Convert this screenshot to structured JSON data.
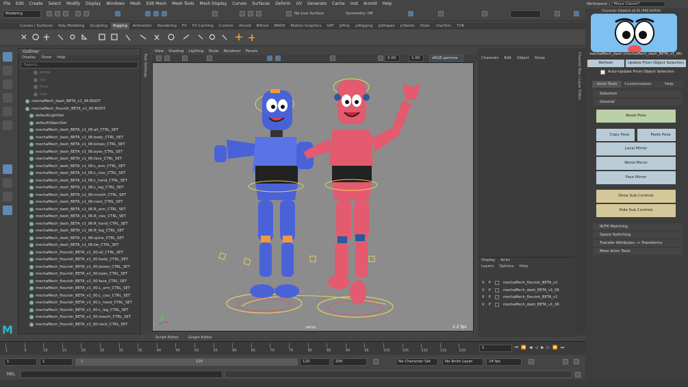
{
  "menubar": [
    "File",
    "Edit",
    "Create",
    "Select",
    "Modify",
    "Display",
    "Windows",
    "Mesh",
    "Edit Mesh",
    "Mesh Tools",
    "Mesh Display",
    "Curves",
    "Surfaces",
    "Deform",
    "UV",
    "Generate",
    "Cache",
    "mst",
    "Arnold",
    "Help"
  ],
  "status": {
    "mode": "Modeling",
    "live_surface": "No Live Surface",
    "symmetry": "Symmetry: Off"
  },
  "workspace": {
    "label": "Workspace :",
    "value": "Maya Classic*"
  },
  "shelf_tabs": [
    "Curves / Surfaces",
    "Poly Modeling",
    "Sculpting",
    "Rigging",
    "Animation",
    "Rendering",
    "FX",
    "FX Caching",
    "Custom",
    "Arnold",
    "Bifrost",
    "MASH",
    "Motion Graphics",
    "SAT",
    "jsPoly",
    "jsRigging",
    "jsShapes",
    "jsTanim",
    "XGen",
    "charSim",
    "TUR"
  ],
  "shelf_active": "Rigging",
  "outliner": {
    "title": "Outliner",
    "menu": [
      "Display",
      "Show",
      "Help"
    ],
    "search_placeholder": "Search...",
    "cameras": [
      "persp",
      "top",
      "front",
      "side"
    ],
    "rows": [
      "mechaMech_dash_BETA_v1_06:ROOT",
      "mechaMech_flourish_BETA_v1_00:ROOT",
      "defaultLightSet",
      "defaultObjectSet",
      "mechaMech_dash_BETA_v1_06:all_CTRL_SET",
      "mechaMech_dash_BETA_v1_06:body_CTRL_SET",
      "mechaMech_dash_BETA_v1_06:brows_CTRL_SET",
      "mechaMech_dash_BETA_v1_06:eyes_CTRL_SET",
      "mechaMech_dash_BETA_v1_06:face_CTRL_SET",
      "mechaMech_dash_BETA_v1_06:L_arm_CTRL_SET",
      "mechaMech_dash_BETA_v1_06:L_clav_CTRL_SET",
      "mechaMech_dash_BETA_v1_06:L_hand_CTRL_SET",
      "mechaMech_dash_BETA_v1_06:L_leg_CTRL_SET",
      "mechaMech_dash_BETA_v1_06:mouth_CTRL_SET",
      "mechaMech_dash_BETA_v1_06:neck_CTRL_SET",
      "mechaMech_dash_BETA_v1_06:R_arm_CTRL_SET",
      "mechaMech_dash_BETA_v1_06:R_clav_CTRL_SET",
      "mechaMech_dash_BETA_v1_06:R_hand_CTRL_SET",
      "mechaMech_dash_BETA_v1_06:R_leg_CTRL_SET",
      "mechaMech_dash_BETA_v1_06:spine_CTRL_SET",
      "mechaMech_dash_BETA_v1_06:tie_CTRL_SET",
      "mechaMech_flourish_BETA_v1_00:all_CTRL_SET",
      "mechaMech_flourish_BETA_v1_00:body_CTRL_SET",
      "mechaMech_flourish_BETA_v1_00:brows_CTRL_SET",
      "mechaMech_flourish_BETA_v1_00:eyes_CTRL_SET",
      "mechaMech_flourish_BETA_v1_00:face_CTRL_SET",
      "mechaMech_flourish_BETA_v1_00:L_arm_CTRL_SET",
      "mechaMech_flourish_BETA_v1_00:L_clav_CTRL_SET",
      "mechaMech_flourish_BETA_v1_00:L_hand_CTRL_SET",
      "mechaMech_flourish_BETA_v1_00:L_leg_CTRL_SET",
      "mechaMech_flourish_BETA_v1_00:mouth_CTRL_SET",
      "mechaMech_flourish_BETA_v1_00:neck_CTRL_SET"
    ]
  },
  "side_label": "Tool Settings",
  "viewport": {
    "menu": [
      "View",
      "Shading",
      "Lighting",
      "Show",
      "Renderer",
      "Panels"
    ],
    "exposure": "0.00",
    "gamma": "1.00",
    "colorspace": "sRGB gamma",
    "camera": "persp",
    "fps": "2.2 fps"
  },
  "editor_tabs": [
    "Script Editor",
    "Graph Editor"
  ],
  "channelbox": {
    "menu": [
      "Channels",
      "Edit",
      "Object",
      "Show"
    ]
  },
  "right_strip_label": "Channel Box / Layer Editor",
  "layers": {
    "tabs": [
      "Display",
      "Anim"
    ],
    "menu": [
      "Layers",
      "Options",
      "Help"
    ],
    "rows": [
      "mechaMech_flourish_BETA_v1",
      "mechaMech_dash_BETA_v1_06",
      "mechaMech_flourish_BETA_v1",
      "mechaMech_dash_BETA_v1_06"
    ],
    "v": "V",
    "p": "P"
  },
  "anim_tools": {
    "title": "Character Sidekick v0.01 (PRE-ALPHA)",
    "selected": "mechaMech_dash (mechaMech_dash_BETA_v1_06)",
    "refresh": "Refresh",
    "update": "Update From Object Selection",
    "auto_update": "Auto-Update From Object Selection",
    "tabs": [
      "Anim Tools",
      "Customization",
      "Help"
    ],
    "selection": "Selection",
    "general": "General",
    "reset_pose": "Reset Pose",
    "copy_pose": "Copy Pose",
    "paste_pose": "Paste Pose",
    "local_mirror": "Local Mirror",
    "world_mirror": "World Mirror",
    "face_mirror": "Face Mirror",
    "show_sub": "Show Sub Controls",
    "hide_sub": "Hide Sub Controls",
    "sections": [
      "IK/FK Matching",
      "Space Switching",
      "Transfer Attributes -> Transforms",
      "More Anim Tools"
    ]
  },
  "timeline": {
    "ticks": [
      "1",
      "5",
      "10",
      "15",
      "20",
      "25",
      "30",
      "35",
      "40",
      "45",
      "50",
      "55",
      "60",
      "65",
      "70",
      "75",
      "80",
      "85",
      "90",
      "95",
      "100",
      "105",
      "110",
      "115",
      "120"
    ],
    "current": "1"
  },
  "range": {
    "start": "1",
    "start2": "1",
    "slider_start": "1",
    "slider_end": "120",
    "end": "120",
    "end2": "200",
    "char_set": "No Character Set",
    "anim_layer": "No Anim Layer",
    "fps": "24 fps"
  },
  "mel": "MEL"
}
